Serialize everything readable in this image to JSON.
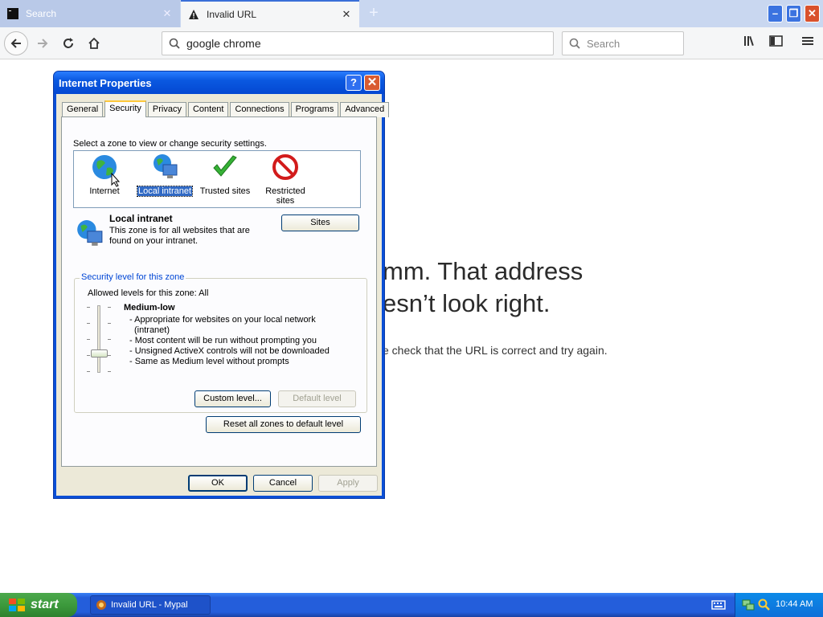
{
  "browser": {
    "tabs": [
      {
        "title": "Search",
        "active": false
      },
      {
        "title": "Invalid URL",
        "active": true
      }
    ],
    "url": "google chrome",
    "search_placeholder": "Search"
  },
  "page": {
    "error_title_line1": "mm. That address",
    "error_title_line2": "esn’t look right.",
    "error_description": "e check that the URL is correct and try again."
  },
  "dialog": {
    "title": "Internet Properties",
    "help_glyph": "?",
    "tabs": [
      "General",
      "Security",
      "Privacy",
      "Content",
      "Connections",
      "Programs",
      "Advanced"
    ],
    "selected_tab": "Security",
    "zone_prompt": "Select a zone to view or change security settings.",
    "zones": [
      {
        "label": "Internet",
        "icon": "globe-icon"
      },
      {
        "label": "Local intranet",
        "icon": "intranet-icon",
        "selected": true
      },
      {
        "label": "Trusted sites",
        "icon": "checkmark-icon"
      },
      {
        "label": "Restricted sites",
        "icon": "restricted-icon"
      }
    ],
    "zone_info": {
      "name": "Local intranet",
      "description": "This zone is for all websites that are found on your intranet."
    },
    "sites_button": "Sites",
    "security_group": {
      "caption": "Security level for this zone",
      "allowed": "Allowed levels for this zone: All",
      "level_name": "Medium-low",
      "level_details": [
        "- Appropriate for websites on your local network (intranet)",
        "- Most content will be run without prompting you",
        "- Unsigned ActiveX controls will not be downloaded",
        "- Same as Medium level without prompts"
      ],
      "custom_button": "Custom level...",
      "default_button": "Default level"
    },
    "reset_button": "Reset all zones to default level",
    "ok_button": "OK",
    "cancel_button": "Cancel",
    "apply_button": "Apply"
  },
  "taskbar": {
    "start_label": "start",
    "item_label": "Invalid URL - Mypal",
    "clock": "10:44 AM"
  },
  "colors": {
    "xp_blue": "#0b4fd6",
    "dialog_face": "#ece9d8",
    "selection": "#316ac5",
    "taskbar": "#245edb",
    "start_green": "#3c9a3c"
  }
}
